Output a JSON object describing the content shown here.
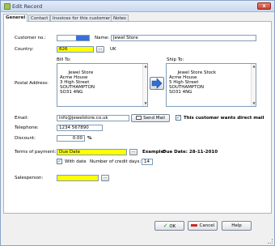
{
  "window": {
    "title": "Edit Record",
    "close_label": "x"
  },
  "tabs": [
    {
      "label": "Generel",
      "active": true
    },
    {
      "label": "Contact",
      "active": false
    },
    {
      "label": "Invoices for this customer",
      "active": false
    },
    {
      "label": "Notes",
      "active": false
    }
  ],
  "form": {
    "customer_no_label": "Customer no.:",
    "customer_no_value": "",
    "name_label": "Name:",
    "name_value": "Jewel Store",
    "country_label": "Country:",
    "country_value": "826",
    "country_name": "UK",
    "bill_to_label": "Bill To:",
    "ship_to_label": "Ship To:",
    "postal_address_label": "Postal Address:",
    "bill_to_lines": "Jewel Store\nAcme House\n3 High Street\nSOUTHAMPTON\nSO31 4NG",
    "ship_to_lines": "Jewel Store Stock\nAcme House\n5 High Street\nSOUTHAMPTON\nSO31 4NG",
    "email_label": "Email:",
    "email_value": "info@jewelstore.co.uk",
    "send_mail_label": "Send Mail",
    "direct_mail_label": "This customer wants direct mail",
    "direct_mail_checked": true,
    "telephone_label": "Telephone:",
    "telephone_value": "1234 567890",
    "discount_label": "Discount:",
    "discount_value": "0.00",
    "discount_unit": "%",
    "terms_label": "Terms of payment:",
    "terms_value": "Due Date",
    "example_label": "Example:",
    "example_value": "Due Date: 28-11-2010",
    "with_date_label": "With date",
    "with_date_checked": true,
    "credit_days_label": "Number of credit days:",
    "credit_days_value": "14",
    "salesperson_label": "Salesperson:",
    "salesperson_value": "",
    "browse_label": "..."
  },
  "footer": {
    "ok_label": "OK",
    "cancel_label": "Cancel",
    "help_label": "Help"
  },
  "colors": {
    "highlight": "#ffff00",
    "accent": "#3a6fd8"
  },
  "icons": [
    "record-icon",
    "close-icon",
    "browse-icon",
    "copy-arrow-icon",
    "mail-icon",
    "check-icon",
    "ok-check-icon",
    "cancel-icon"
  ]
}
